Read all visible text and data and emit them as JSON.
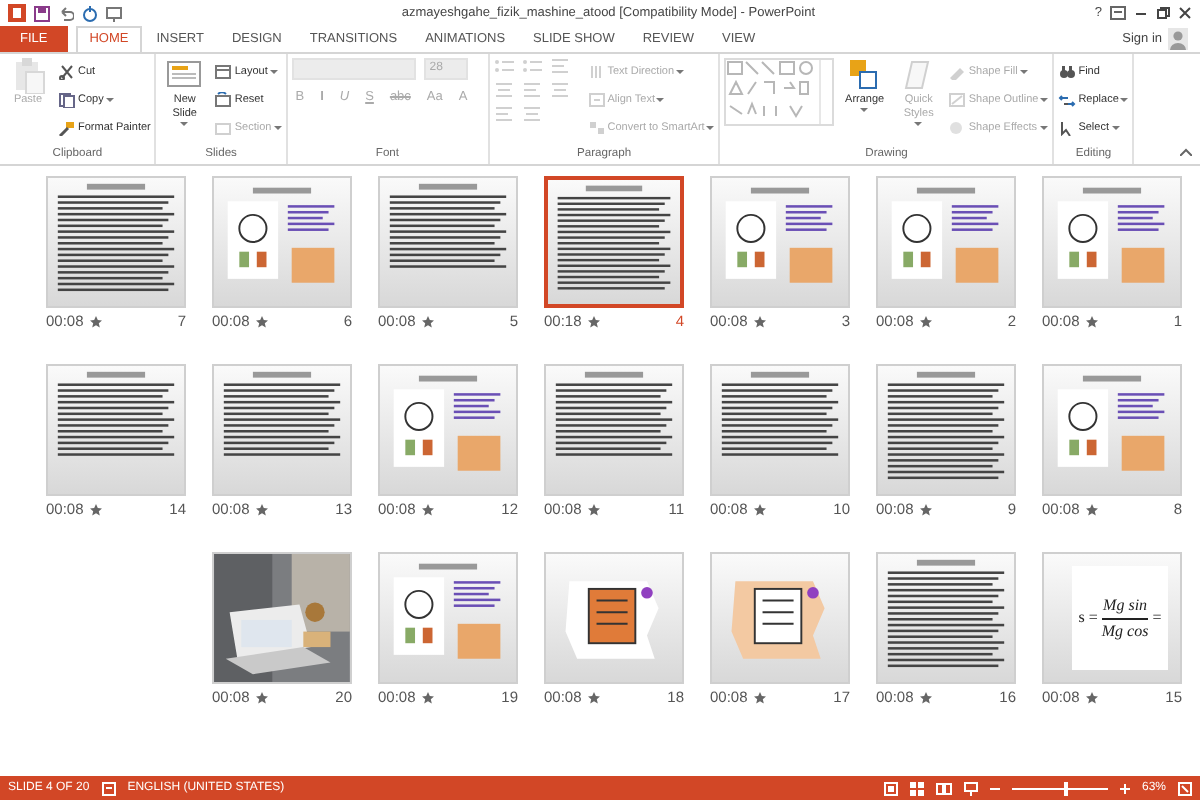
{
  "window": {
    "title": "azmayeshgahe_fizik_mashine_atood [Compatibility Mode] - PowerPoint",
    "help": "?",
    "sign_in": "Sign in"
  },
  "tabs": [
    {
      "label": "FILE",
      "kind": "file",
      "selected": false
    },
    {
      "label": "HOME",
      "kind": "tab",
      "selected": true
    },
    {
      "label": "INSERT",
      "kind": "tab",
      "selected": false
    },
    {
      "label": "DESIGN",
      "kind": "tab",
      "selected": false
    },
    {
      "label": "TRANSITIONS",
      "kind": "tab",
      "selected": false
    },
    {
      "label": "ANIMATIONS",
      "kind": "tab",
      "selected": false
    },
    {
      "label": "SLIDE SHOW",
      "kind": "tab",
      "selected": false
    },
    {
      "label": "REVIEW",
      "kind": "tab",
      "selected": false
    },
    {
      "label": "VIEW",
      "kind": "tab",
      "selected": false
    }
  ],
  "ribbon": [
    {
      "label": "Clipboard",
      "commands": [
        {
          "label": "Paste",
          "kind": "large",
          "disabled": true,
          "dropdown": false
        },
        {
          "label": "Cut",
          "kind": "small",
          "disabled": false,
          "dropdown": false
        },
        {
          "label": "Copy",
          "kind": "small",
          "disabled": false,
          "dropdown": true
        },
        {
          "label": "Format Painter",
          "kind": "small",
          "disabled": false,
          "dropdown": false
        }
      ]
    },
    {
      "label": "Slides",
      "commands": [
        {
          "label": "New Slide",
          "kind": "large",
          "disabled": false,
          "dropdown": true
        },
        {
          "label": "Layout",
          "kind": "small",
          "disabled": false,
          "dropdown": true
        },
        {
          "label": "Reset",
          "kind": "small",
          "disabled": false,
          "dropdown": false
        },
        {
          "label": "Section",
          "kind": "small",
          "disabled": true,
          "dropdown": true
        }
      ]
    },
    {
      "label": "Font",
      "commands": [
        {
          "kind": "font-field",
          "disabled": true
        },
        {
          "label": "28",
          "kind": "size-field",
          "disabled": true
        },
        {
          "label": "B",
          "kind": "glyph",
          "disabled": true
        },
        {
          "label": "I",
          "kind": "glyph",
          "disabled": true
        },
        {
          "label": "U",
          "kind": "glyph",
          "disabled": true
        },
        {
          "label": "S",
          "kind": "glyph",
          "disabled": true
        },
        {
          "label": "abc",
          "kind": "glyph",
          "disabled": true
        },
        {
          "label": "Aa",
          "kind": "glyph",
          "disabled": true
        },
        {
          "label": "A",
          "kind": "glyph",
          "disabled": true
        }
      ]
    },
    {
      "label": "Paragraph",
      "commands": [
        {
          "kind": "icons",
          "disabled": true
        },
        {
          "label": "Text Direction",
          "kind": "small",
          "disabled": true,
          "dropdown": true
        },
        {
          "label": "Align Text",
          "kind": "small",
          "disabled": true,
          "dropdown": true
        },
        {
          "label": "Convert to SmartArt",
          "kind": "small",
          "disabled": true,
          "dropdown": true
        }
      ]
    },
    {
      "label": "Drawing",
      "commands": [
        {
          "kind": "gallery",
          "disabled": true
        },
        {
          "label": "Arrange",
          "kind": "large",
          "disabled": false,
          "dropdown": true
        },
        {
          "label": "Quick Styles",
          "kind": "large",
          "disabled": true,
          "dropdown": true
        },
        {
          "label": "Shape Fill",
          "kind": "small",
          "disabled": true,
          "dropdown": true
        },
        {
          "label": "Shape Outline",
          "kind": "small",
          "disabled": true,
          "dropdown": true
        },
        {
          "label": "Shape Effects",
          "kind": "small",
          "disabled": true,
          "dropdown": true
        }
      ]
    },
    {
      "label": "Editing",
      "commands": [
        {
          "label": "Find",
          "kind": "small",
          "disabled": false,
          "dropdown": false
        },
        {
          "label": "Replace",
          "kind": "small",
          "disabled": false,
          "dropdown": true
        },
        {
          "label": "Select",
          "kind": "small",
          "disabled": false,
          "dropdown": true
        }
      ]
    }
  ],
  "slides": [
    {
      "number": "7",
      "time": "00:08",
      "selected": false,
      "kind": "text"
    },
    {
      "number": "6",
      "time": "00:08",
      "selected": false,
      "kind": "diagram"
    },
    {
      "number": "5",
      "time": "00:08",
      "selected": false,
      "kind": "text"
    },
    {
      "number": "4",
      "time": "00:18",
      "selected": true,
      "kind": "text"
    },
    {
      "number": "3",
      "time": "00:08",
      "selected": false,
      "kind": "diagram"
    },
    {
      "number": "2",
      "time": "00:08",
      "selected": false,
      "kind": "diagram"
    },
    {
      "number": "1",
      "time": "00:08",
      "selected": false,
      "kind": "diagram"
    },
    {
      "number": "14",
      "time": "00:08",
      "selected": false,
      "kind": "text"
    },
    {
      "number": "13",
      "time": "00:08",
      "selected": false,
      "kind": "text"
    },
    {
      "number": "12",
      "time": "00:08",
      "selected": false,
      "kind": "diagram"
    },
    {
      "number": "11",
      "time": "00:08",
      "selected": false,
      "kind": "text"
    },
    {
      "number": "10",
      "time": "00:08",
      "selected": false,
      "kind": "text"
    },
    {
      "number": "9",
      "time": "00:08",
      "selected": false,
      "kind": "text"
    },
    {
      "number": "8",
      "time": "00:08",
      "selected": false,
      "kind": "diagram"
    },
    {
      "number": "20",
      "time": "00:08",
      "selected": false,
      "kind": "picture"
    },
    {
      "number": "19",
      "time": "00:08",
      "selected": false,
      "kind": "diagram"
    },
    {
      "number": "18",
      "time": "00:08",
      "selected": false,
      "kind": "clipart"
    },
    {
      "number": "17",
      "time": "00:08",
      "selected": false,
      "kind": "clipart"
    },
    {
      "number": "16",
      "time": "00:08",
      "selected": false,
      "kind": "text"
    },
    {
      "number": "15",
      "time": "00:08",
      "selected": false,
      "kind": "formula",
      "left": "s =",
      "numerator": "Mg sin",
      "denominator": "Mg cos",
      "right": "="
    }
  ],
  "status_bar": {
    "slide_info": "SLIDE 4 OF 20",
    "language": "ENGLISH (UNITED STATES)",
    "zoom": {
      "level": 0.55,
      "reading": "63%"
    }
  }
}
